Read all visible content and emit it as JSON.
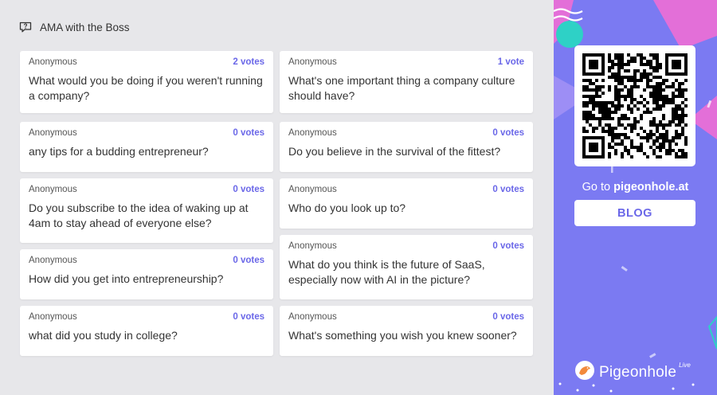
{
  "session": {
    "title": "AMA with the Boss",
    "icon": "question-bubble-icon"
  },
  "questions": {
    "left": [
      {
        "author": "Anonymous",
        "votes": "2 votes",
        "text": "What would you be doing if you weren't running a company?"
      },
      {
        "author": "Anonymous",
        "votes": "0 votes",
        "text": "any tips for a budding entrepreneur?"
      },
      {
        "author": "Anonymous",
        "votes": "0 votes",
        "text": "Do you subscribe to the idea of waking up at 4am to stay ahead of everyone else?"
      },
      {
        "author": "Anonymous",
        "votes": "0 votes",
        "text": "How did you get into entrepreneurship?"
      },
      {
        "author": "Anonymous",
        "votes": "0 votes",
        "text": "what did you study in college?"
      }
    ],
    "right": [
      {
        "author": "Anonymous",
        "votes": "1 vote",
        "text": "What's one important thing a company culture should have?"
      },
      {
        "author": "Anonymous",
        "votes": "0 votes",
        "text": "Do you believe in the survival of the fittest?"
      },
      {
        "author": "Anonymous",
        "votes": "0 votes",
        "text": "Who do you look up to?"
      },
      {
        "author": "Anonymous",
        "votes": "0 votes",
        "text": "What do you think is the future of SaaS, especially now with AI in the picture?"
      },
      {
        "author": "Anonymous",
        "votes": "0 votes",
        "text": "What's something you wish you knew sooner?"
      }
    ]
  },
  "sidebar": {
    "goto_prefix": "Go to",
    "goto_domain": "pigeonhole.at",
    "blog_button": "BLOG",
    "brand_name": "Pigeonhole",
    "brand_suffix": "Live",
    "qr_icon": "qr-code-icon",
    "colors": {
      "accent": "#6a67e8",
      "panel": "#7b7af2",
      "pink": "#e36fd8",
      "teal": "#2ed1c6"
    }
  }
}
